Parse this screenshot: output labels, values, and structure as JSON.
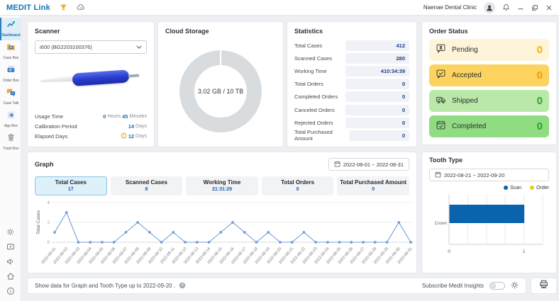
{
  "title_bar": {
    "brand": "MEDIT Link",
    "clinic_name": "Naenae Dental Clinic"
  },
  "sidebar": {
    "items": [
      {
        "label": "Dashboard",
        "icon": "dashboard-chart-icon",
        "active": true
      },
      {
        "label": "Case Box",
        "icon": "case-folder-icon",
        "active": false
      },
      {
        "label": "Order Box",
        "icon": "order-printer-icon",
        "active": false
      },
      {
        "label": "Case Talk",
        "icon": "chat-bubbles-icon",
        "active": false
      },
      {
        "label": "App Box",
        "icon": "app-launch-icon",
        "active": false
      },
      {
        "label": "Trash Box",
        "icon": "trash-bin-icon",
        "active": false
      }
    ],
    "footer_icons": [
      "settings-gear-icon",
      "media-box-icon",
      "announcements-megaphone-icon",
      "home-icon",
      "info-icon"
    ]
  },
  "scanner": {
    "title": "Scanner",
    "device_select_value": "i600 (BG2203100376)",
    "usage_time": {
      "label": "Usage Time",
      "hours": "0",
      "hours_unit": "Hours",
      "minutes": "45",
      "minutes_unit": "Minutes"
    },
    "calibration_period": {
      "label": "Calibration Period",
      "value": "14",
      "unit": "Days"
    },
    "elapsed_days": {
      "label": "Elapsed Days",
      "value": "12",
      "unit": "Days",
      "warning": true
    }
  },
  "cloud_storage": {
    "title": "Cloud Storage"
  },
  "statistics": {
    "title": "Statistics",
    "rows": [
      {
        "label": "Total Cases",
        "value": "412"
      },
      {
        "label": "Scanned Cases",
        "value": "280"
      },
      {
        "label": "Working Time",
        "value": "410:34:39"
      },
      {
        "label": "Total Orders",
        "value": "0"
      },
      {
        "label": "Completed Orders",
        "value": "0"
      },
      {
        "label": "Canceled Orders",
        "value": "0"
      },
      {
        "label": "Rejected Orders",
        "value": "0"
      },
      {
        "label": "Total Purchased Amount",
        "value": "0"
      }
    ]
  },
  "order_status": {
    "title": "Order Status",
    "items": [
      {
        "label": "Pending",
        "count": "0",
        "icon": "hourglass-bubble-icon",
        "bg_color": "#fdf4d9",
        "count_color": "#f2b30d"
      },
      {
        "label": "Accepted",
        "count": "0",
        "icon": "check-bubble-icon",
        "bg_color": "#fbd35e",
        "count_color": "#ef9f07"
      },
      {
        "label": "Shipped",
        "count": "0",
        "icon": "truck-icon",
        "bg_color": "#b9e8a8",
        "count_color": "#2fa52f"
      },
      {
        "label": "Completed",
        "count": "0",
        "icon": "calendar-check-icon",
        "bg_color": "#90dc83",
        "count_color": "#27a327"
      }
    ]
  },
  "graph": {
    "title": "Graph",
    "tabs": [
      {
        "label": "Total Cases",
        "value": "17",
        "active": true
      },
      {
        "label": "Scanned Cases",
        "value": "8",
        "active": false
      },
      {
        "label": "Working Time",
        "value": "21:31:29",
        "active": false
      },
      {
        "label": "Total Orders",
        "value": "0",
        "active": false
      },
      {
        "label": "Total Purchased Amount",
        "value": "0",
        "active": false
      }
    ]
  },
  "tooth_type": {
    "title": "Tooth Type"
  },
  "footer": {
    "notice": "Show data for Graph and Tooth Type up to 2022-09-20 .",
    "subscribe_label": "Subscribe Medit Insights",
    "toggle_state": "off"
  },
  "chart_data": [
    {
      "type": "line",
      "title": "Graph - Total Cases",
      "date_range": "2022-08-01 ~ 2022-08-31",
      "ylabel": "Total Cases",
      "xlabel": "",
      "ylim": [
        0,
        4
      ],
      "yticks": [
        0,
        2,
        4
      ],
      "grid": true,
      "line_color": "#6f9fd8",
      "x": [
        "2022-08-01",
        "2022-08-02",
        "2022-08-03",
        "2022-08-04",
        "2022-08-05",
        "2022-08-06",
        "2022-08-07",
        "2022-08-08",
        "2022-08-09",
        "2022-08-10",
        "2022-08-11",
        "2022-08-12",
        "2022-08-13",
        "2022-08-14",
        "2022-08-15",
        "2022-08-16",
        "2022-08-17",
        "2022-08-18",
        "2022-08-19",
        "2022-08-20",
        "2022-08-21",
        "2022-08-22",
        "2022-08-23",
        "2022-08-24",
        "2022-08-25",
        "2022-08-26",
        "2022-08-27",
        "2022-08-28",
        "2022-08-29",
        "2022-08-30",
        "2022-08-31"
      ],
      "values": [
        1,
        3,
        0,
        0,
        0,
        0,
        1,
        2,
        1,
        0,
        1,
        0,
        0,
        0,
        1,
        2,
        1,
        0,
        1,
        0,
        0,
        1,
        0,
        0,
        0,
        0,
        0,
        0,
        0,
        2,
        0
      ]
    },
    {
      "type": "bar",
      "orientation": "horizontal",
      "title": "Tooth Type",
      "date_range": "2022-08-21 ~ 2022-09-20",
      "categories": [
        "Crown"
      ],
      "series": [
        {
          "name": "Scan",
          "color": "#0a63ad",
          "values": [
            1
          ]
        },
        {
          "name": "Order",
          "color": "#f2c71b",
          "values": [
            0
          ]
        }
      ],
      "xlim": [
        0,
        1.25
      ],
      "xticks": [
        0,
        1
      ],
      "grid": true,
      "legend_position": "top-right"
    },
    {
      "type": "donut",
      "title": "Cloud Storage",
      "label": "3.02 GB / 10 TB",
      "used": "3.02 GB",
      "total": "10 TB",
      "ring_color": "#d9dcdf"
    }
  ]
}
